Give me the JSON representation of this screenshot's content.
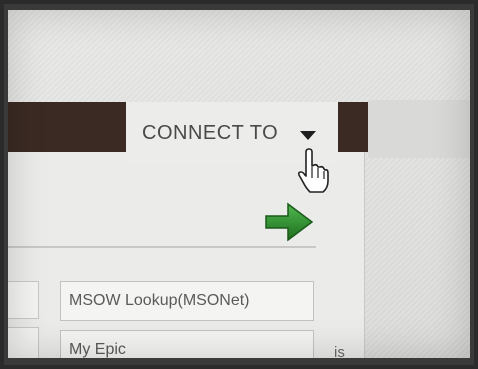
{
  "header": {
    "connect_label": "CONNECT TO"
  },
  "fields": {
    "lookup": "MSOW Lookup(MSONet)",
    "epic": "My Epic"
  },
  "fragments": {
    "is": "is"
  },
  "icons": {
    "caret": "caret-down-icon",
    "cursor": "hand-pointer-icon",
    "go": "green-arrow-icon"
  },
  "colors": {
    "top_bar": "#3b2a24",
    "arrow": "#2e8b2e"
  }
}
